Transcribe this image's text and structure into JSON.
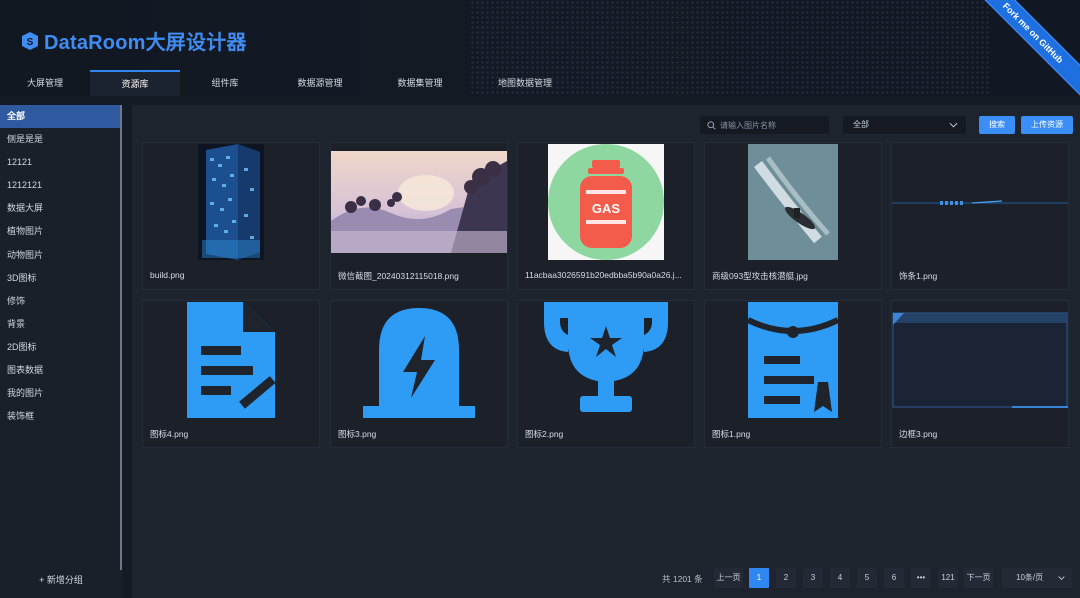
{
  "header": {
    "brand": "DataRoom大屏设计器",
    "ribbon": "Fork me on GitHub",
    "tabs": [
      "大屏管理",
      "资源库",
      "组件库",
      "数据源管理",
      "数据集管理",
      "地图数据管理"
    ],
    "active_tab": 1
  },
  "sidebar": {
    "items": [
      "全部",
      "侧是是是",
      "12121",
      "1212121",
      "数据大屏",
      "植物图片",
      "动物图片",
      "3D图标",
      "修饰",
      "背景",
      "2D图标",
      "图表数据",
      "我的图片",
      "装饰框"
    ],
    "active": 0,
    "add_group": "+ 新增分组"
  },
  "toolbar": {
    "search_placeholder": "请输入图片名称",
    "select_value": "全部",
    "search_button": "搜索",
    "upload_button": "上传资源"
  },
  "cards": [
    {
      "name": "build.png",
      "icon": "building-thumbnail"
    },
    {
      "name": "微信截图_20240312115018.png",
      "icon": "landscape-thumbnail"
    },
    {
      "name": "11acbaa3026591b20edbba5b90a0a26.j...",
      "icon": "gas-tank-thumbnail",
      "label": "GAS"
    },
    {
      "name": "商级093型攻击核潜艇.jpg",
      "icon": "submarine-thumbnail"
    },
    {
      "name": "饰条1.png",
      "icon": "strip-thumbnail"
    },
    {
      "name": "图标4.png",
      "icon": "document-edit-icon"
    },
    {
      "name": "图标3.png",
      "icon": "lightning-icon"
    },
    {
      "name": "图标2.png",
      "icon": "trophy-icon"
    },
    {
      "name": "图标1.png",
      "icon": "clipboard-icon"
    },
    {
      "name": "边框3.png",
      "icon": "border-frame-thumbnail"
    }
  ],
  "pagination": {
    "total": "共 1201 条",
    "prev": "上一页",
    "next": "下一页",
    "pages": [
      "1",
      "2",
      "3",
      "4",
      "5",
      "6",
      "•••",
      "121"
    ],
    "active_page": "1",
    "page_size": "10条/页"
  },
  "colors": {
    "accent": "#2f87f2",
    "brand": "#3f8cf2",
    "icon_blue": "#2e9bf5"
  }
}
